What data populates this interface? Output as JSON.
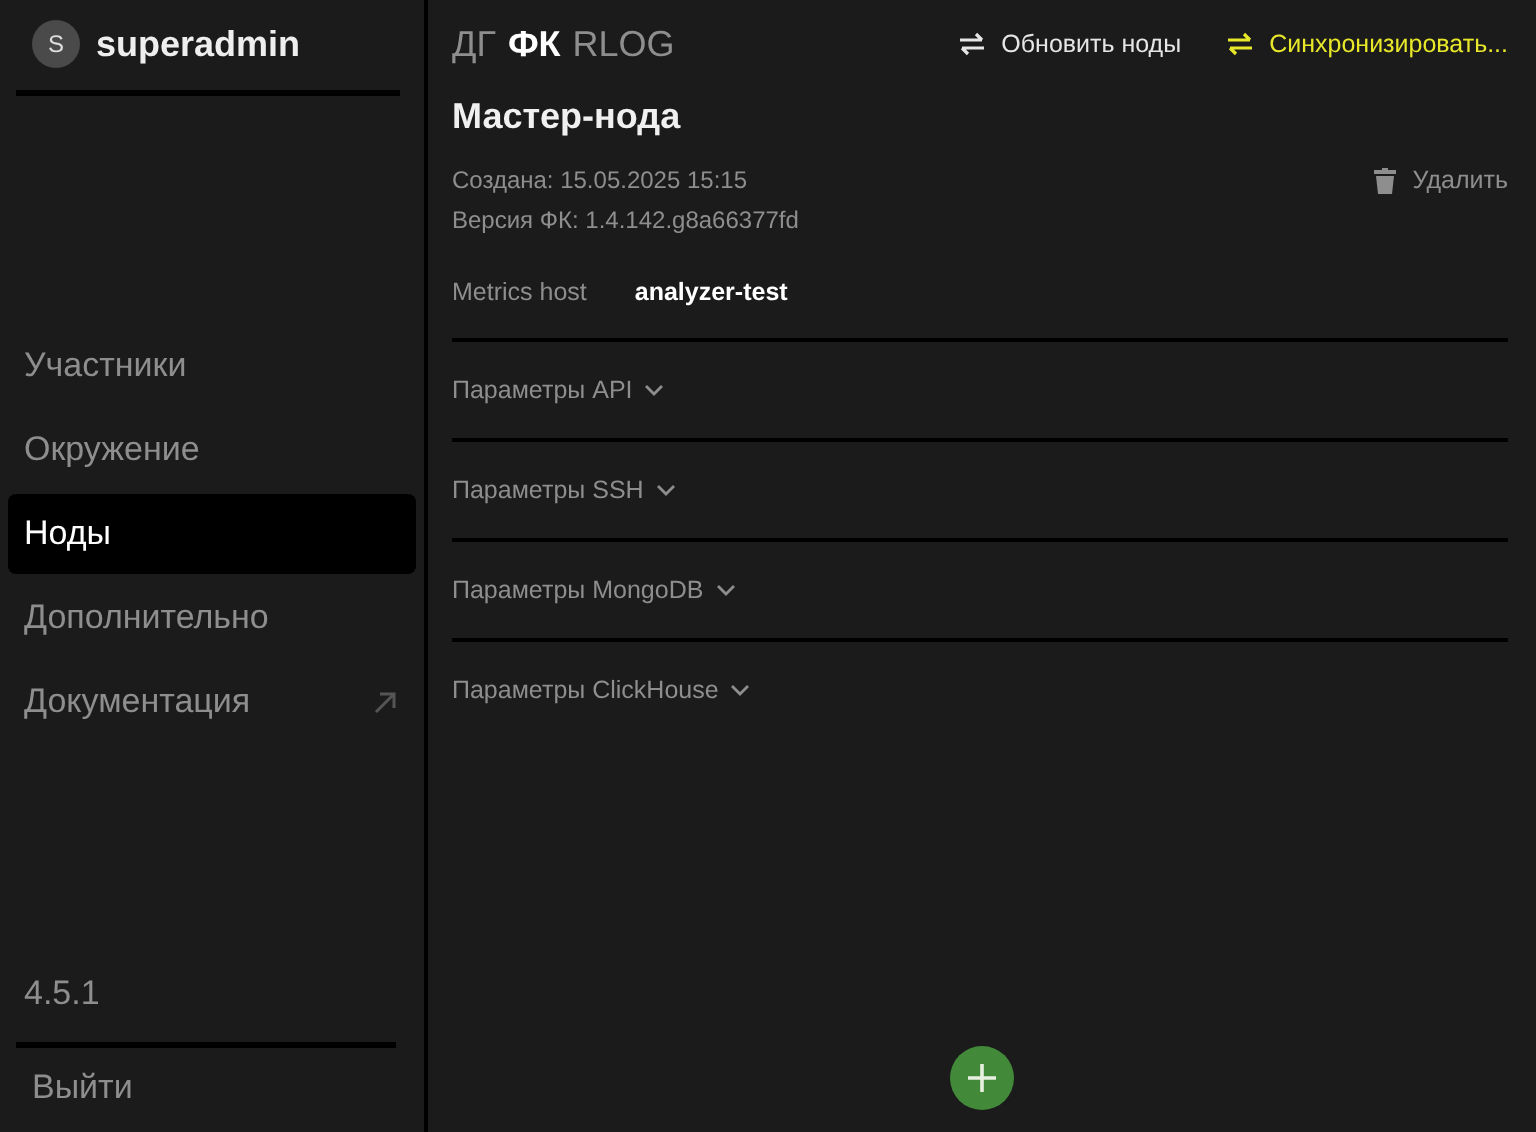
{
  "user": {
    "initial": "S",
    "name": "superadmin"
  },
  "nav": [
    {
      "label": "Участники",
      "selected": false,
      "external": false
    },
    {
      "label": "Окружение",
      "selected": false,
      "external": false
    },
    {
      "label": "Ноды",
      "selected": true,
      "external": false
    },
    {
      "label": "Дополнительно",
      "selected": false,
      "external": false
    },
    {
      "label": "Документация",
      "selected": false,
      "external": true
    }
  ],
  "version": "4.5.1",
  "logout": "Выйти",
  "tabs": [
    {
      "label": "ДГ",
      "selected": false
    },
    {
      "label": "ФК",
      "selected": true
    },
    {
      "label": "RLOG",
      "selected": false
    }
  ],
  "actions": [
    {
      "label": "Обновить ноды",
      "highlighted": false
    },
    {
      "label": "Синхронизировать...",
      "highlighted": true
    }
  ],
  "node": {
    "title": "Мастер-нода",
    "created": "Создана: 15.05.2025 15:15",
    "version": "Версия ФК: 1.4.142.g8a66377fd",
    "delete": "Удалить",
    "metrics_label": "Metrics host",
    "metrics_value": "analyzer-test"
  },
  "sections": [
    {
      "label": "Параметры API",
      "expanded": false
    },
    {
      "label": "Параметры SSH",
      "expanded": false
    },
    {
      "label": "Параметры MongoDB",
      "expanded": false
    },
    {
      "label": "Параметры ClickHouse",
      "expanded": false
    }
  ]
}
